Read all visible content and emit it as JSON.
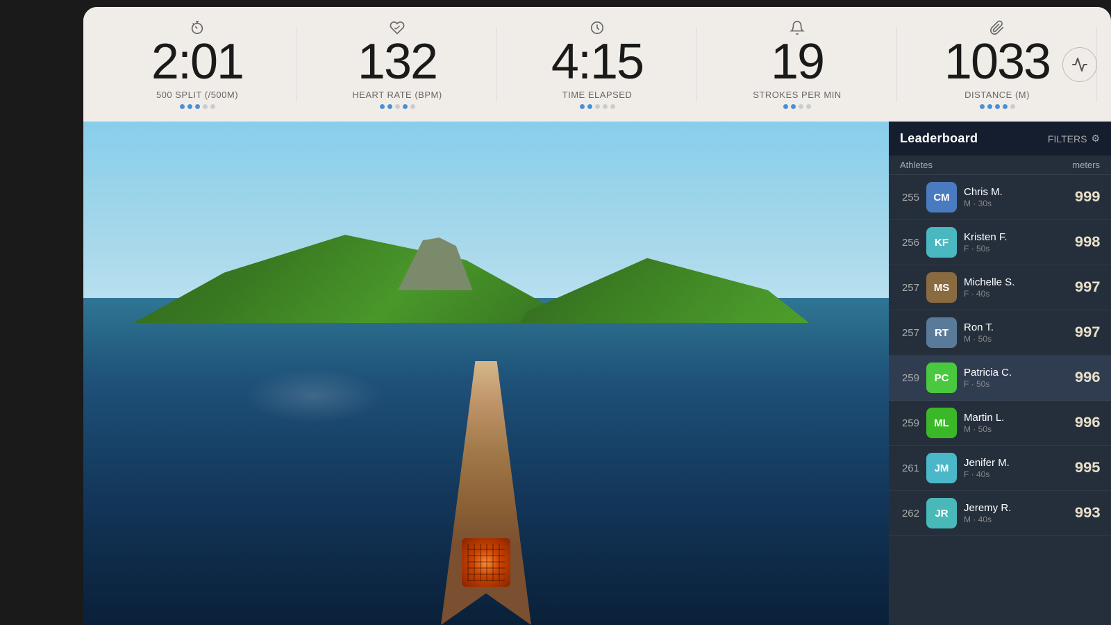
{
  "stats": {
    "split": {
      "value": "2:01",
      "label": "500 SPLIT (/500M)",
      "icon": "timer-icon",
      "dots": [
        true,
        true,
        true,
        false,
        false
      ]
    },
    "heartrate": {
      "value": "132",
      "label": "HEART RATE (BPM)",
      "icon": "heart-icon",
      "dots": [
        true,
        true,
        false,
        true,
        false
      ]
    },
    "time": {
      "value": "4:15",
      "label": "TIME ELAPSED",
      "icon": "clock-icon",
      "dots": [
        true,
        true,
        false,
        false,
        false
      ]
    },
    "strokes": {
      "value": "19",
      "label": "STROKES PER MIN",
      "icon": "bell-icon",
      "dots": [
        true,
        true,
        false,
        false,
        false
      ]
    },
    "distance": {
      "value": "1033",
      "label": "DISTANCE (M)",
      "icon": "paperclip-icon",
      "dots": [
        true,
        true,
        true,
        true,
        false
      ]
    }
  },
  "leaderboard": {
    "title": "Leaderboard",
    "filters_label": "FILTERS",
    "col_athletes": "Athletes",
    "col_meters": "meters",
    "rows": [
      {
        "rank": "255",
        "initials": "CM",
        "avatar_class": "avatar-cm",
        "name": "Chris M.",
        "meta": "M · 30s",
        "meters": "999",
        "highlighted": false
      },
      {
        "rank": "256",
        "initials": "KF",
        "avatar_class": "avatar-kf",
        "name": "Kristen F.",
        "meta": "F · 50s",
        "meters": "998",
        "highlighted": false
      },
      {
        "rank": "257",
        "initials": "MS",
        "avatar_class": "avatar-ms",
        "name": "Michelle S.",
        "meta": "F · 40s",
        "meters": "997",
        "highlighted": false
      },
      {
        "rank": "257",
        "initials": "RT",
        "avatar_class": "avatar-rt",
        "name": "Ron T.",
        "meta": "M · 50s",
        "meters": "997",
        "highlighted": false
      },
      {
        "rank": "259",
        "initials": "PC",
        "avatar_class": "avatar-pc",
        "name": "Patricia C.",
        "meta": "F · 50s",
        "meters": "996",
        "highlighted": true
      },
      {
        "rank": "259",
        "initials": "ML",
        "avatar_class": "avatar-ml",
        "name": "Martin L.",
        "meta": "M · 50s",
        "meters": "996",
        "highlighted": false
      },
      {
        "rank": "261",
        "initials": "JM",
        "avatar_class": "avatar-jm",
        "name": "Jenifer M.",
        "meta": "F · 40s",
        "meters": "995",
        "highlighted": false
      },
      {
        "rank": "262",
        "initials": "JR",
        "avatar_class": "avatar-jr",
        "name": "Jeremy R.",
        "meta": "M · 40s",
        "meters": "993",
        "highlighted": false
      }
    ]
  }
}
